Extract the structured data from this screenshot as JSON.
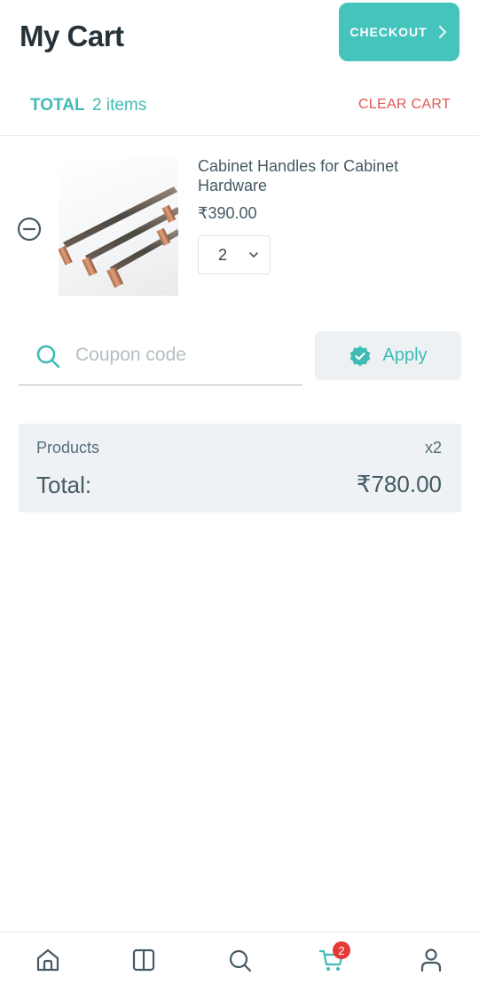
{
  "header": {
    "title": "My Cart",
    "checkout_label": "CHECKOUT"
  },
  "summary": {
    "total_label": "TOTAL",
    "items_count": "2 items",
    "clear_cart_label": "CLEAR CART"
  },
  "cart_items": [
    {
      "name": "Cabinet Handles for Cabinet Hardware",
      "price": "₹390.00",
      "quantity": "2",
      "image_icon": "cabinet-handles-photo"
    }
  ],
  "coupon": {
    "placeholder": "Coupon code",
    "value": "",
    "apply_label": "Apply"
  },
  "totals": {
    "products_label": "Products",
    "products_qty": "x2",
    "total_label": "Total:",
    "total_value": "₹780.00"
  },
  "bottom_nav": {
    "items": [
      {
        "icon": "home-icon"
      },
      {
        "icon": "catalog-icon"
      },
      {
        "icon": "search-icon"
      },
      {
        "icon": "cart-icon",
        "badge": "2",
        "active": true
      },
      {
        "icon": "profile-icon"
      }
    ]
  },
  "colors": {
    "accent": "#45c4be",
    "danger": "#e25656",
    "badge": "#e53935",
    "panel": "#eff2f4"
  }
}
